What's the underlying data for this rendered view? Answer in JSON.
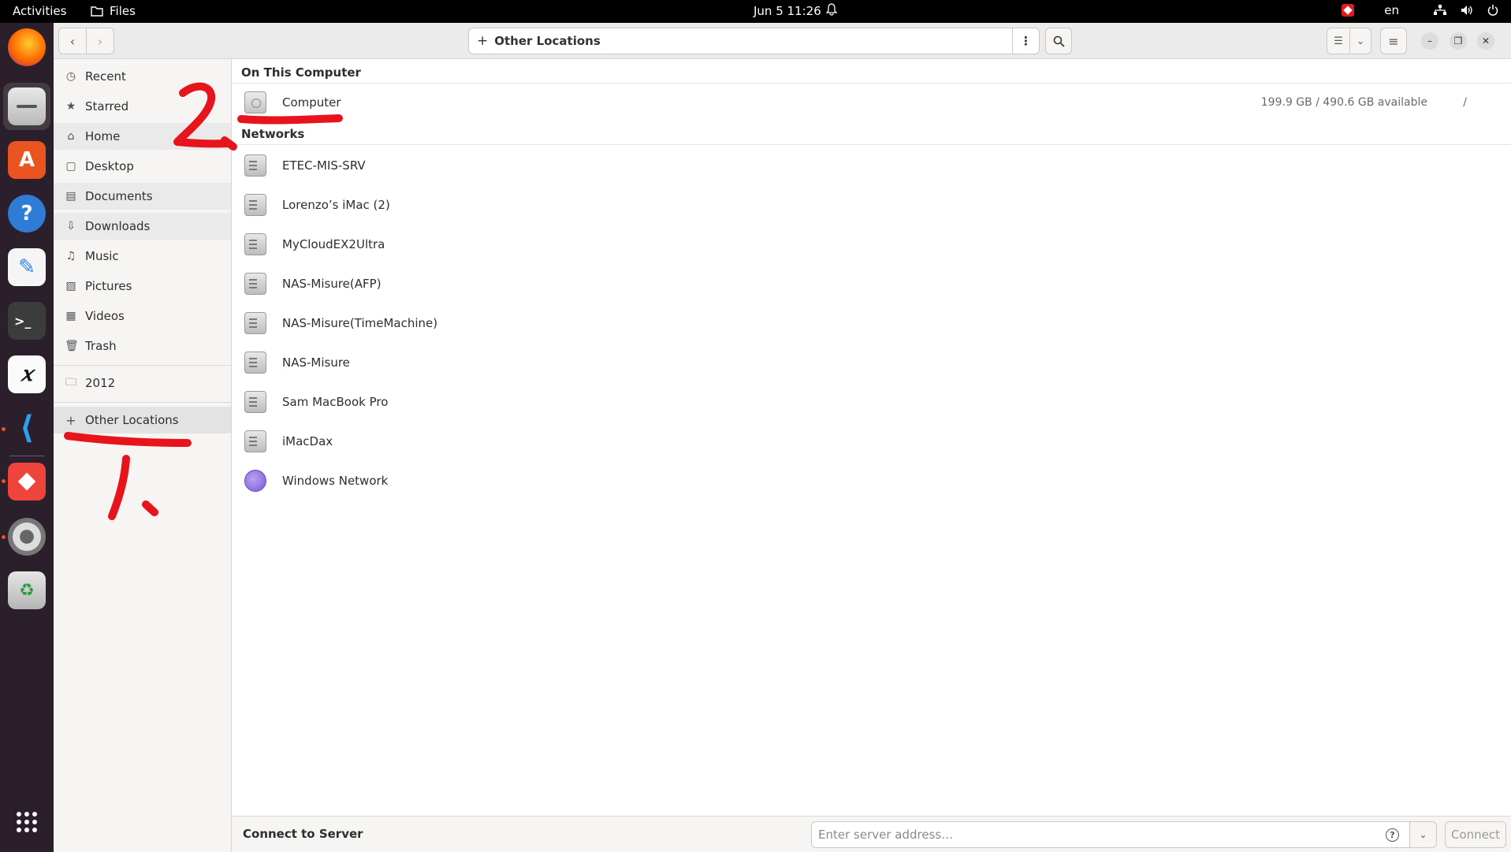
{
  "topbar": {
    "activities": "Activities",
    "app_name": "Files",
    "clock": "Jun 5  11:26",
    "lang": "en"
  },
  "headerbar": {
    "location_label": "Other Locations"
  },
  "sidebar": {
    "items": [
      {
        "label": "Recent",
        "icon": "clock-icon"
      },
      {
        "label": "Starred",
        "icon": "star-icon"
      },
      {
        "label": "Home",
        "icon": "home-icon"
      },
      {
        "label": "Desktop",
        "icon": "desktop-icon"
      },
      {
        "label": "Documents",
        "icon": "documents-icon"
      },
      {
        "label": "Downloads",
        "icon": "download-icon"
      },
      {
        "label": "Music",
        "icon": "music-icon"
      },
      {
        "label": "Pictures",
        "icon": "pictures-icon"
      },
      {
        "label": "Videos",
        "icon": "videos-icon"
      },
      {
        "label": "Trash",
        "icon": "trash-icon"
      }
    ],
    "bookmarks": [
      {
        "label": "2012",
        "icon": "folder-icon"
      }
    ],
    "other_locations": {
      "label": "Other Locations",
      "icon": "plus-icon"
    }
  },
  "main": {
    "on_this_computer": {
      "header": "On This Computer",
      "items": [
        {
          "name": "Computer",
          "info": "199.9 GB / 490.6 GB available",
          "path": "/"
        }
      ]
    },
    "networks": {
      "header": "Networks",
      "items": [
        {
          "name": "ETEC-MIS-SRV"
        },
        {
          "name": "Lorenzo’s iMac (2)"
        },
        {
          "name": "MyCloudEX2Ultra"
        },
        {
          "name": "NAS-Misure(AFP)"
        },
        {
          "name": "NAS-Misure(TimeMachine)"
        },
        {
          "name": "NAS-Misure"
        },
        {
          "name": "Sam MacBook Pro"
        },
        {
          "name": "iMacDax"
        },
        {
          "name": "Windows Network"
        }
      ]
    }
  },
  "footer": {
    "label": "Connect to Server",
    "placeholder": "Enter server address…",
    "connect_label": "Connect"
  },
  "annotations": {
    "mark_1": "1.",
    "mark_2": "2.",
    "color": "#e8141c"
  }
}
